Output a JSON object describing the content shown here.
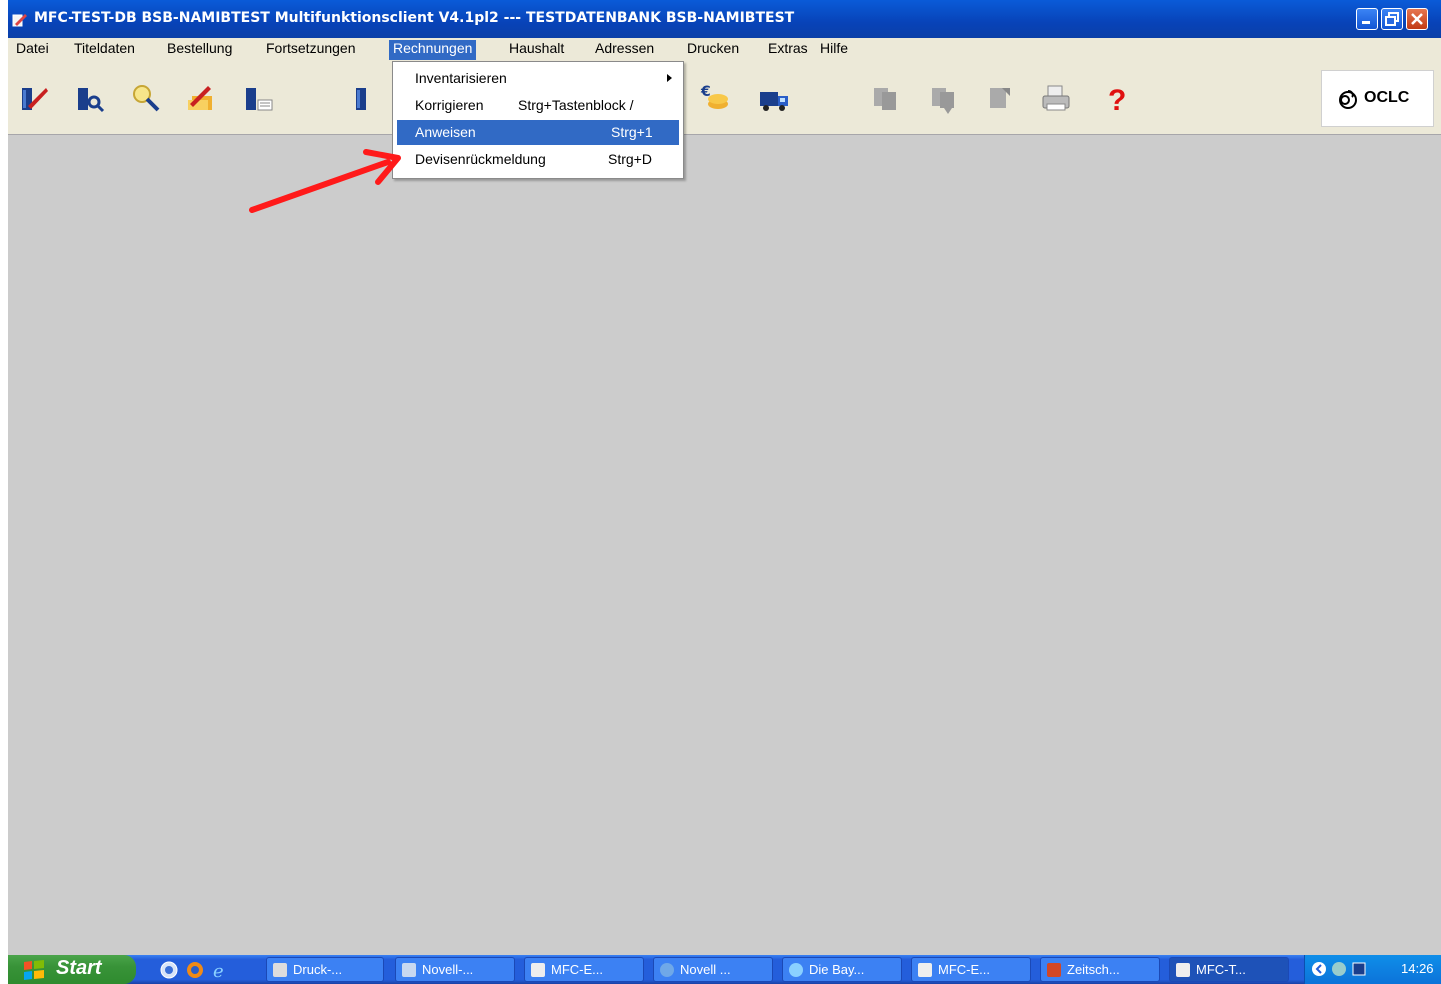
{
  "window": {
    "title": "MFC-TEST-DB BSB-NAMIBTEST Multifunktionsclient V4.1pl2 --- TESTDATENBANK BSB-NAMIBTEST"
  },
  "menubar": {
    "items": [
      {
        "label": "Datei"
      },
      {
        "label": "Titeldaten"
      },
      {
        "label": "Bestellung"
      },
      {
        "label": "Fortsetzungen"
      },
      {
        "label": "Rechnungen",
        "active": true
      },
      {
        "label": "Haushalt"
      },
      {
        "label": "Adressen"
      },
      {
        "label": "Drucken"
      },
      {
        "label": "Extras"
      },
      {
        "label": "Hilfe"
      }
    ]
  },
  "dropdown": {
    "items": [
      {
        "label": "Inventarisieren",
        "shortcut": "",
        "submenu": true
      },
      {
        "label": "Korrigieren",
        "shortcut": "Strg+Tastenblock /"
      },
      {
        "label": "Anweisen",
        "shortcut": "Strg+1",
        "selected": true
      },
      {
        "label": "Devisenrückmeldung",
        "shortcut": "Strg+D"
      }
    ]
  },
  "toolbar": {
    "logo_text": "OCLC",
    "icons": [
      "book-edit-icon",
      "book-search-icon",
      "magnifier-icon",
      "edit-folders-icon",
      "book-list-icon",
      "book-icon",
      "invoice-edit-icon",
      "euro-coins-icon",
      "delivery-truck-icon",
      "copy-icon",
      "paste-icon",
      "document-icon",
      "printer-icon",
      "help-icon"
    ]
  },
  "taskbar": {
    "start_label": "Start",
    "buttons": [
      {
        "label": "Druck-...",
        "icon": "printer-icon"
      },
      {
        "label": "Novell-...",
        "icon": "novell-icon"
      },
      {
        "label": "MFC-E...",
        "icon": "mfc-icon"
      },
      {
        "label": "Novell ...",
        "icon": "globe-icon"
      },
      {
        "label": "Die Bay...",
        "icon": "ie-icon"
      },
      {
        "label": "MFC-E...",
        "icon": "mfc-icon"
      },
      {
        "label": "Zeitsch...",
        "icon": "powerpoint-icon"
      },
      {
        "label": "MFC-T...",
        "icon": "mfc-icon",
        "active": true
      }
    ],
    "clock": "14:26"
  },
  "colors": {
    "titlebar": "#0a4fc8",
    "menu_highlight": "#316ac5",
    "workspace": "#cccccc",
    "annotation_arrow": "#ff1a1a"
  }
}
